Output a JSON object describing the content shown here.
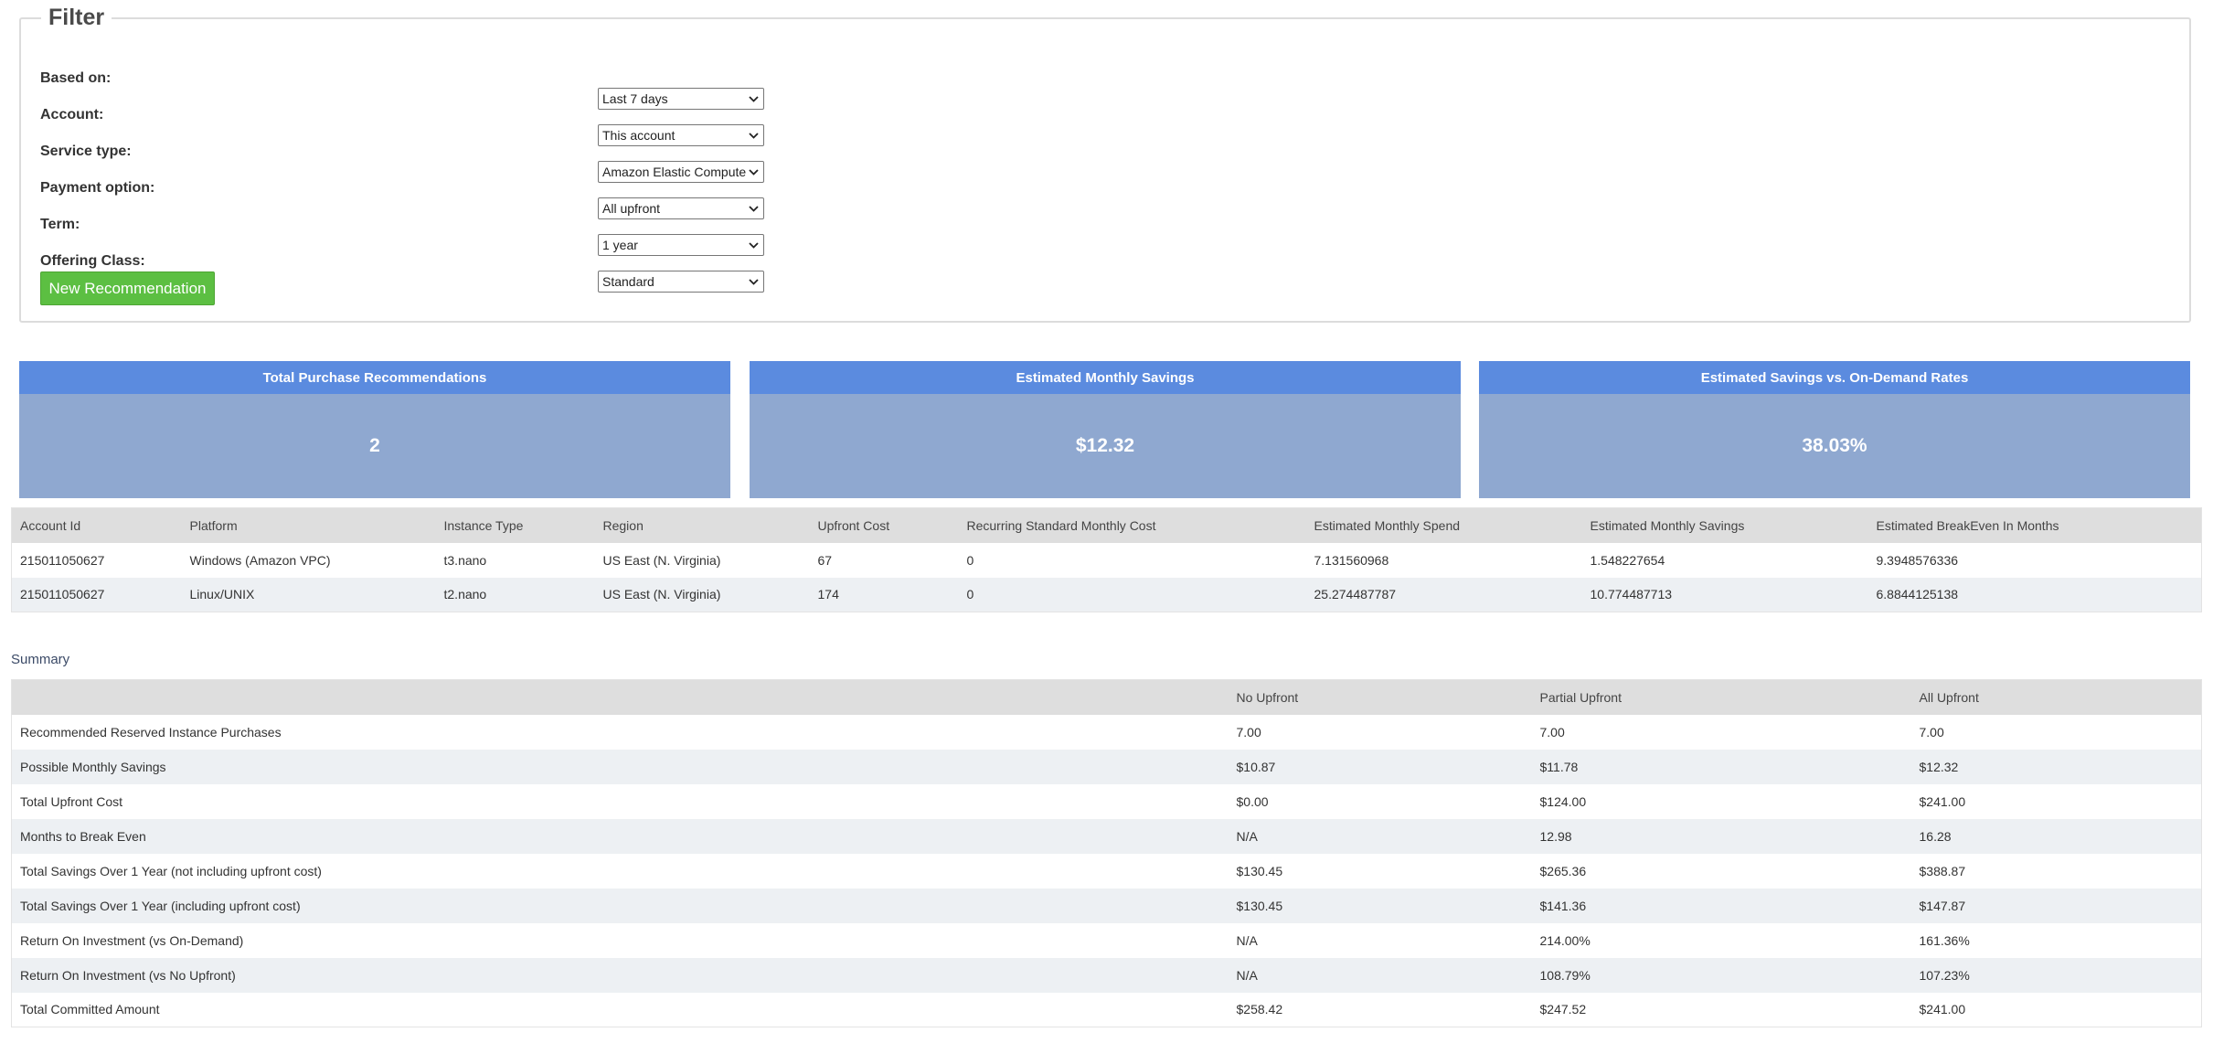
{
  "filter": {
    "legend": "Filter",
    "fields": [
      {
        "label": "Based on:",
        "value": "Last 7 days"
      },
      {
        "label": "Account:",
        "value": "This account"
      },
      {
        "label": "Service type:",
        "value": "Amazon Elastic Compute Cloud"
      },
      {
        "label": "Payment option:",
        "value": "All upfront"
      },
      {
        "label": "Term:",
        "value": "1 year"
      },
      {
        "label": "Offering Class:",
        "value": "Standard"
      }
    ],
    "button_label": "New Recommendation"
  },
  "stats": [
    {
      "title": "Total Purchase Recommendations",
      "value": "2"
    },
    {
      "title": "Estimated Monthly Savings",
      "value": "$12.32"
    },
    {
      "title": "Estimated Savings vs. On-Demand Rates",
      "value": "38.03%"
    }
  ],
  "recommendations": {
    "headers": [
      "Account Id",
      "Platform",
      "Instance Type",
      "Region",
      "Upfront Cost",
      "Recurring Standard Monthly Cost",
      "Estimated Monthly Spend",
      "Estimated Monthly Savings",
      "Estimated BreakEven In Months"
    ],
    "rows": [
      [
        "215011050627",
        "Windows (Amazon VPC)",
        "t3.nano",
        "US East (N. Virginia)",
        "67",
        "0",
        "7.131560968",
        "1.548227654",
        "9.3948576336"
      ],
      [
        "215011050627",
        "Linux/UNIX",
        "t2.nano",
        "US East (N. Virginia)",
        "174",
        "0",
        "25.274487787",
        "10.774487713",
        "6.8844125138"
      ]
    ]
  },
  "summary": {
    "caption": "Summary",
    "headers": [
      "",
      "No Upfront",
      "Partial Upfront",
      "All Upfront"
    ],
    "rows": [
      [
        "Recommended Reserved Instance Purchases",
        "7.00",
        "7.00",
        "7.00"
      ],
      [
        "Possible Monthly Savings",
        "$10.87",
        "$11.78",
        "$12.32"
      ],
      [
        "Total Upfront Cost",
        "$0.00",
        "$124.00",
        "$241.00"
      ],
      [
        "Months to Break Even",
        "N/A",
        "12.98",
        "16.28"
      ],
      [
        "Total Savings Over 1 Year (not including upfront cost)",
        "$130.45",
        "$265.36",
        "$388.87"
      ],
      [
        "Total Savings Over 1 Year (including upfront cost)",
        "$130.45",
        "$141.36",
        "$147.87"
      ],
      [
        "Return On Investment (vs On-Demand)",
        "N/A",
        "214.00%",
        "161.36%"
      ],
      [
        "Return On Investment (vs No Upfront)",
        "N/A",
        "108.79%",
        "107.23%"
      ],
      [
        "Total Committed Amount",
        "$258.42",
        "$247.52",
        "$241.00"
      ]
    ]
  }
}
